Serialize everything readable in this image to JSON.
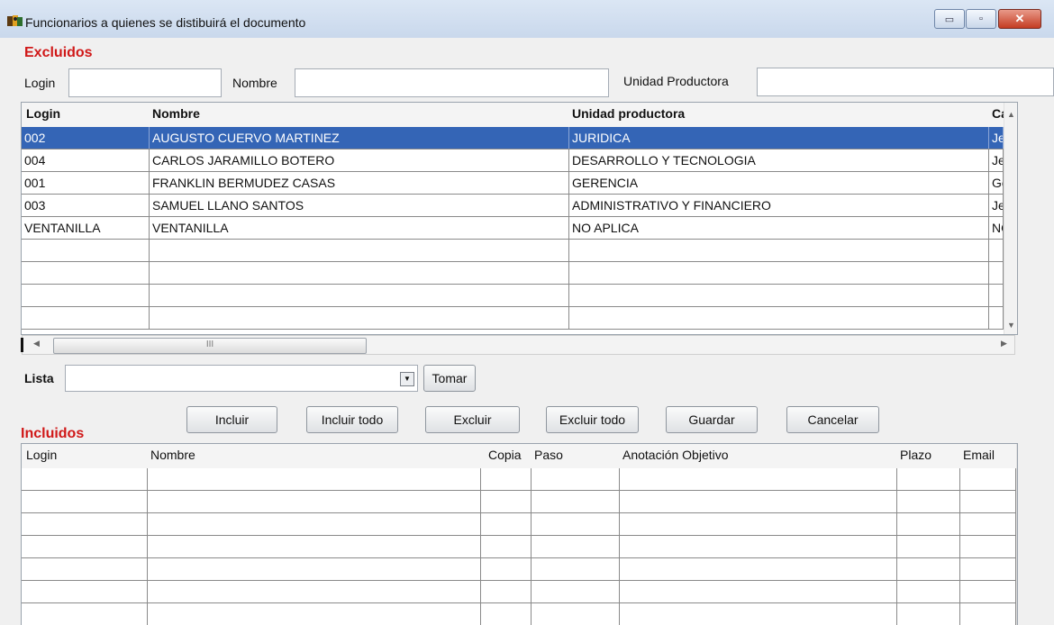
{
  "window": {
    "title": "Funcionarios a quienes se distibuirá el documento",
    "controls": {
      "minimize": "▭",
      "maximize": "▫",
      "close": "✕"
    }
  },
  "excluidos": {
    "heading": "Excluidos",
    "filters": {
      "login_label": "Login",
      "login_value": "",
      "nombre_label": "Nombre",
      "nombre_value": "",
      "unidad_label": "Unidad Productora",
      "unidad_value": ""
    },
    "columns": [
      "Login",
      "Nombre",
      "Unidad productora",
      "Carg"
    ],
    "rows": [
      {
        "login": "002",
        "nombre": "AUGUSTO CUERVO MARTINEZ",
        "unidad": "JURIDICA",
        "cargo": "Jefe",
        "selected": true
      },
      {
        "login": "004",
        "nombre": "CARLOS JARAMILLO BOTERO",
        "unidad": "DESARROLLO Y TECNOLOGIA",
        "cargo": "Jefe",
        "selected": false
      },
      {
        "login": "001",
        "nombre": "FRANKLIN BERMUDEZ CASAS",
        "unidad": "GERENCIA",
        "cargo": "Ger",
        "selected": false
      },
      {
        "login": "003",
        "nombre": "SAMUEL LLANO SANTOS",
        "unidad": "ADMINISTRATIVO Y FINANCIERO",
        "cargo": "Jefe",
        "selected": false
      },
      {
        "login": "VENTANILLA",
        "nombre": "VENTANILLA",
        "unidad": "NO APLICA",
        "cargo": "NO",
        "selected": false
      },
      {
        "login": "",
        "nombre": "",
        "unidad": "",
        "cargo": "",
        "selected": false
      },
      {
        "login": "",
        "nombre": "",
        "unidad": "",
        "cargo": "",
        "selected": false
      },
      {
        "login": "",
        "nombre": "",
        "unidad": "",
        "cargo": "",
        "selected": false
      },
      {
        "login": "",
        "nombre": "",
        "unidad": "",
        "cargo": "",
        "selected": false
      }
    ],
    "hscroll_thumb": "III"
  },
  "lista": {
    "label": "Lista",
    "value": "",
    "tomar_label": "Tomar"
  },
  "actions": {
    "incluir": "Incluir",
    "incluir_todo": "Incluir todo",
    "excluir": "Excluir",
    "excluir_todo": "Excluir todo",
    "guardar": "Guardar",
    "cancelar": "Cancelar"
  },
  "incluidos": {
    "heading": "Incluidos",
    "columns": [
      "Login",
      "Nombre",
      "Copia",
      "Paso",
      "Anotación Objetivo",
      "Plazo",
      "Email"
    ],
    "empty_rows": 7
  },
  "colors": {
    "selection": "#3465b6",
    "heading_red": "#d01818"
  }
}
